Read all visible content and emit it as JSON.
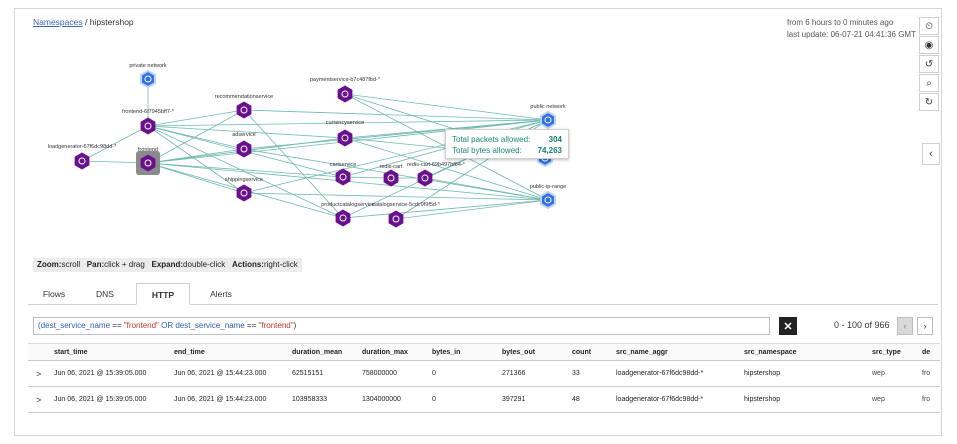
{
  "breadcrumb": {
    "root": "Namespaces",
    "sep": " / ",
    "current": "hipstershop"
  },
  "time": {
    "range": "from 6 hours to 0 minutes ago",
    "updated": "last update: 06-07-21 04:41:36 GMT"
  },
  "toolbar": [
    {
      "name": "clock-icon",
      "glyph": "⏲"
    },
    {
      "name": "eye-icon",
      "glyph": "◉"
    },
    {
      "name": "undo-icon",
      "glyph": "↺"
    },
    {
      "name": "search-icon",
      "glyph": "⌕"
    },
    {
      "name": "refresh-icon",
      "glyph": "↻"
    }
  ],
  "collapse_glyph": "‹",
  "graph": {
    "node_color": "#6a0f8e",
    "network_color": "#2f6fe0",
    "selected_color": "#8a8a8a",
    "nodes": [
      {
        "id": "private-network",
        "label": "private network",
        "kind": "network"
      },
      {
        "id": "frontend-pod",
        "label": "frontend-6f7945bff7-*",
        "kind": "pod"
      },
      {
        "id": "frontend",
        "label": "frontend",
        "kind": "selected"
      },
      {
        "id": "loadgenerator",
        "label": "loadgenerator-67f6dc98dd-*",
        "kind": "pod"
      },
      {
        "id": "recommendationservice",
        "label": "recommendationservice",
        "kind": "service"
      },
      {
        "id": "adservice",
        "label": "adservice",
        "kind": "service"
      },
      {
        "id": "shippingservice",
        "label": "shippingservice",
        "kind": "service"
      },
      {
        "id": "paymentservice",
        "label": "paymentservice-b7c487fbd-*",
        "kind": "pod"
      },
      {
        "id": "currencyservice",
        "label": "currencyservice",
        "kind": "service"
      },
      {
        "id": "cartservice",
        "label": "cartservice",
        "kind": "service"
      },
      {
        "id": "redis-cart-svc",
        "label": "redis-cart",
        "kind": "service"
      },
      {
        "id": "redis-cart",
        "label": "redis-cart-69b497bf64-*",
        "kind": "pod"
      },
      {
        "id": "productcatalogservice",
        "label": "productcatalogservice",
        "kind": "service"
      },
      {
        "id": "catalog-pod",
        "label": "catalogservice-5cdc9f9f5d-*",
        "kind": "pod"
      },
      {
        "id": "public-network",
        "label": "public network",
        "kind": "network"
      },
      {
        "id": "public-ip-range",
        "label": "public-ip-range",
        "kind": "network"
      },
      {
        "id": "hidden-net",
        "label": "",
        "kind": "network"
      }
    ]
  },
  "tooltip": {
    "packets_label": "Total packets allowed:",
    "packets_value": "304",
    "bytes_label": "Total bytes allowed:",
    "bytes_value": "74,263"
  },
  "legend": {
    "zoom_k": "Zoom:",
    "zoom_v": "scroll",
    "pan_k": "Pan:",
    "pan_v": "click + drag",
    "expand_k": "Expand:",
    "expand_v": "double-click",
    "actions_k": "Actions:",
    "actions_v": "right-click"
  },
  "tabs": [
    {
      "label": "Flows",
      "active": false
    },
    {
      "label": "DNS",
      "active": false
    },
    {
      "label": "HTTP",
      "active": true
    },
    {
      "label": "Alerts",
      "active": false
    }
  ],
  "query": {
    "p1": "(dest_service_name",
    "op1": " == ",
    "v1": "\"frontend\"",
    "or": " OR ",
    "p2": "dest_service_name",
    "op2": " == ",
    "v2": "\"frontend\"",
    "end": ")"
  },
  "clear_glyph": "✕",
  "pager": {
    "text": "0 - 100 of 966",
    "prev": "‹",
    "next": "›"
  },
  "table": {
    "columns": [
      "",
      "start_time",
      "end_time",
      "duration_mean",
      "duration_max",
      "bytes_in",
      "bytes_out",
      "count",
      "src_name_aggr",
      "src_namespace",
      "src_type",
      "de"
    ],
    "rows": [
      [
        ">",
        "Jun 06, 2021 @ 15:39:05.000",
        "Jun 06, 2021 @ 15:44:23.000",
        "62515151",
        "758000000",
        "0",
        "271366",
        "33",
        "loadgenerator-67f6dc98dd-*",
        "hipstershop",
        "wep",
        "fro"
      ],
      [
        ">",
        "Jun 06, 2021 @ 15:39:05.000",
        "Jun 06, 2021 @ 15:44:23.000",
        "103958333",
        "1304000000",
        "0",
        "397291",
        "48",
        "loadgenerator-67f6dc98dd-*",
        "hipstershop",
        "wep",
        "fro"
      ]
    ]
  }
}
